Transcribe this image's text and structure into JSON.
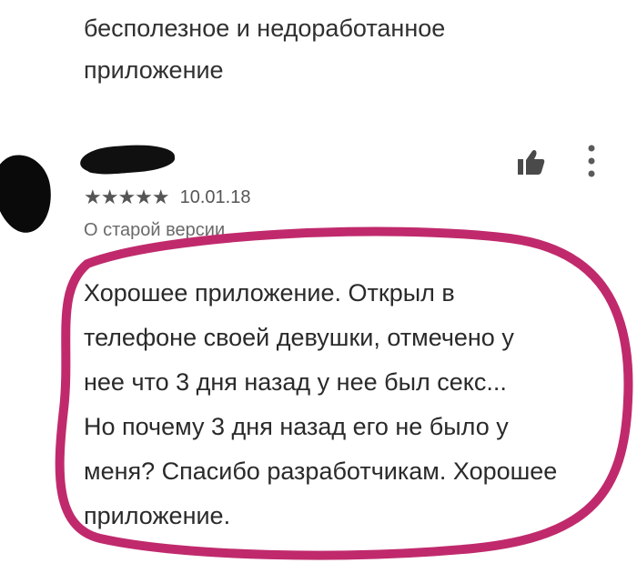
{
  "previous_review": {
    "text": "бесполезное и недоработанное\nприложение"
  },
  "review": {
    "stars": "★★★★★",
    "rating": 5,
    "date": "10.01.18",
    "version_label": "О старой версии",
    "body": "Хорошее приложение. Открыл в\nтелефоне своей девушки, отмечено у\nнее что 3 дня назад у нее был секс...\nНо почему 3 дня назад его не было у\nменя? Спасибо разработчикам. Хорошее\nприложение.",
    "icons": {
      "like": "thumbs-up-icon",
      "menu": "more-vertical-icon",
      "avatar": "avatar"
    }
  },
  "colors": {
    "highlight_circle": "#c02a6c"
  }
}
